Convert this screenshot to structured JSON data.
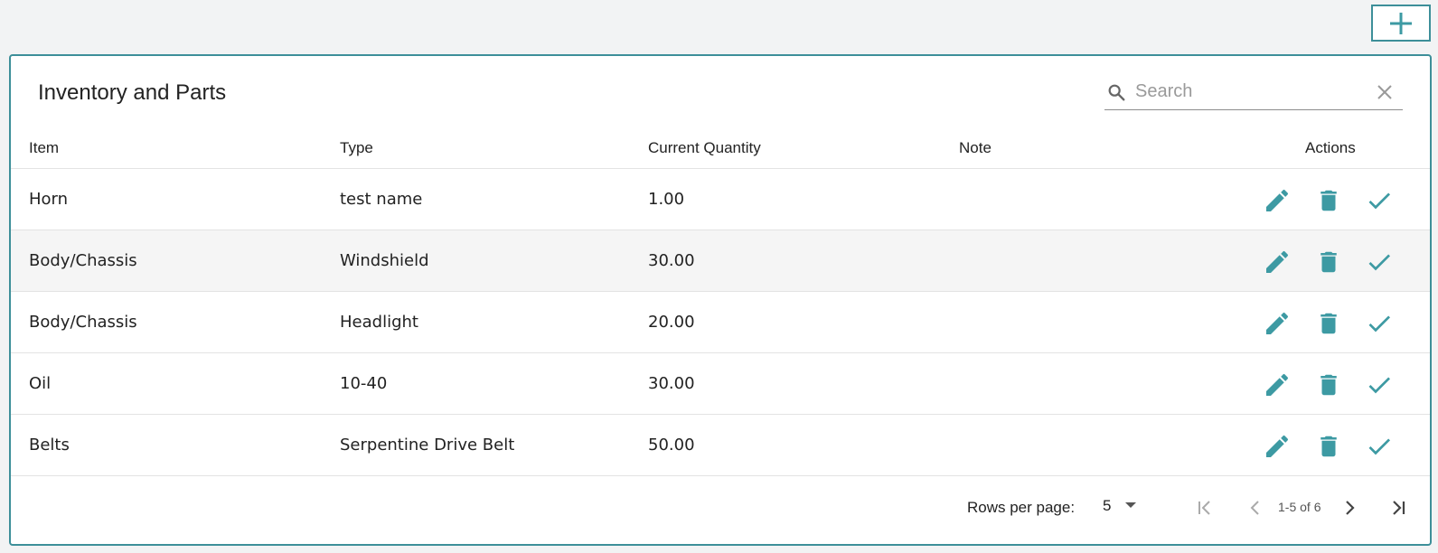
{
  "table": {
    "title": "Inventory and Parts",
    "search_placeholder": "Search",
    "columns": [
      "Item",
      "Type",
      "Current Quantity",
      "Note",
      "Actions"
    ],
    "rows": [
      {
        "item": "Horn",
        "type": "test name",
        "quantity": "1.00",
        "note": ""
      },
      {
        "item": "Body/Chassis",
        "type": "Windshield",
        "quantity": "30.00",
        "note": ""
      },
      {
        "item": "Body/Chassis",
        "type": "Headlight",
        "quantity": "20.00",
        "note": ""
      },
      {
        "item": "Oil",
        "type": "10-40",
        "quantity": "30.00",
        "note": ""
      },
      {
        "item": "Belts",
        "type": "Serpentine Drive Belt",
        "quantity": "50.00",
        "note": ""
      }
    ]
  },
  "pagination": {
    "rows_per_page_label": "Rows per page:",
    "rows_per_page": "5",
    "range": "1-5 of 6"
  },
  "icons": {
    "add": "plus-icon",
    "search": "search-icon",
    "clear": "close-icon",
    "edit": "pencil-icon",
    "delete": "trash-icon",
    "confirm": "check-icon"
  },
  "colors": {
    "accent": "#3d9aa3",
    "border": "#3d8f99",
    "row_shade": "#f5f5f5"
  }
}
